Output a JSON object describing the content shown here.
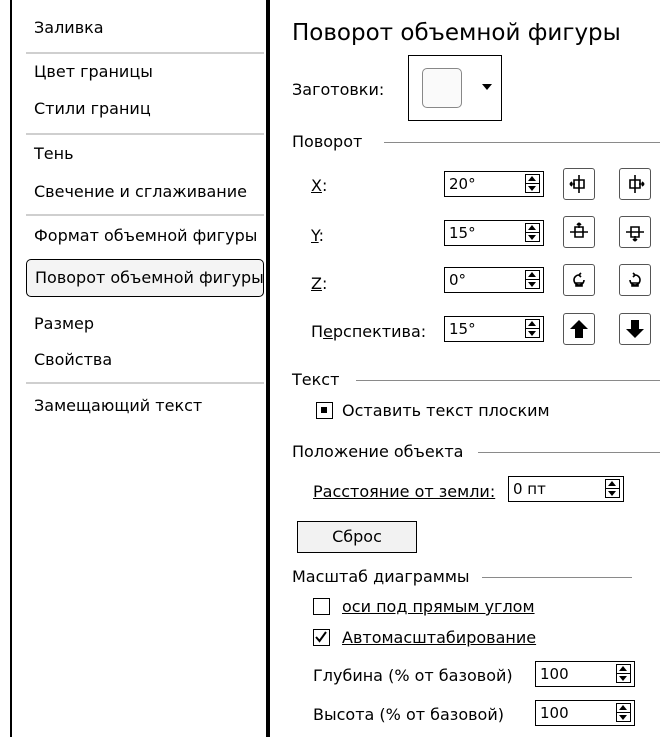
{
  "sidebar": {
    "items": [
      {
        "label": "Заливка"
      },
      {
        "label": "Цвет границы"
      },
      {
        "label": "Стили границ"
      },
      {
        "label": "Тень"
      },
      {
        "label": "Свечение и сглаживание"
      },
      {
        "label": "Формат объемной фигуры"
      },
      {
        "label": "Поворот объемной фигуры",
        "selected": true
      },
      {
        "label": "Размер"
      },
      {
        "label": "Свойства"
      },
      {
        "label": "Замещающий текст"
      }
    ]
  },
  "panel": {
    "title": "Поворот объемной фигуры",
    "presets": {
      "label": "Заготовки:"
    },
    "rotation": {
      "group_label": "Поворот",
      "x": {
        "label": "X:",
        "value": "20°"
      },
      "y": {
        "label": "Y:",
        "value": "15°"
      },
      "z": {
        "label": "Z:",
        "value": "0°"
      },
      "perspective": {
        "label": "Перспектива:",
        "value": "15°"
      }
    },
    "text": {
      "group_label": "Текст",
      "keep_flat_label": "Оставить текст плоским",
      "keep_flat_checked": true
    },
    "position": {
      "group_label": "Положение объекта",
      "distance_label": "Расстояние от земли:",
      "distance_value": "0 пт"
    },
    "reset_label": "Сброс",
    "chart_scale": {
      "group_label": "Масштаб диаграммы",
      "right_angle_axes_label": "оси под прямым углом",
      "right_angle_axes_checked": false,
      "autoscale_label": "Автомасштабирование",
      "autoscale_checked": true,
      "depth_label": "Глубина (% от базовой)",
      "depth_value": "100",
      "height_label": "Высота (% от базовой)",
      "height_value": "100"
    }
  }
}
